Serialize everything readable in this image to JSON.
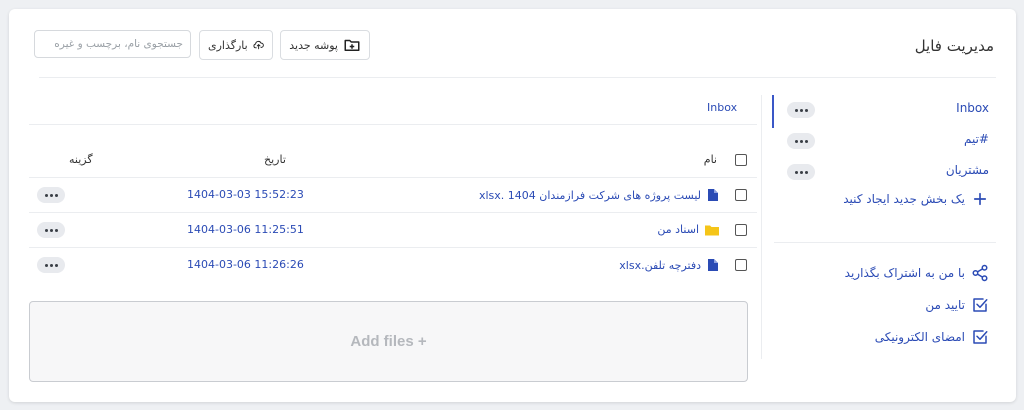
{
  "header": {
    "title": "مدیریت فایل",
    "new_folder_label": "پوشه جدید",
    "upload_label": "بارگذاری",
    "search_placeholder": "جستجوی نام، برچسب و غیره"
  },
  "sidebar": {
    "sections": [
      {
        "label": "Inbox",
        "active": true
      },
      {
        "label": "#تیم"
      },
      {
        "label": "مشتریان"
      }
    ],
    "create_section_label": "یک بخش جدید ایجاد کنید",
    "links": [
      {
        "label": "با من به اشتراک بگذارید",
        "icon": "share-icon"
      },
      {
        "label": "تایید من",
        "icon": "checkbox-icon"
      },
      {
        "label": "امضای الکترونیکی",
        "icon": "checkbox-icon"
      }
    ]
  },
  "main": {
    "breadcrumb": "Inbox",
    "columns": {
      "name": "نام",
      "date": "تاریخ",
      "option": "گزینه"
    },
    "rows": [
      {
        "name": "لیست پروژه های شرکت فرازمندان 1404 .xlsx",
        "date": "1404-03-03 15:52:23",
        "type": "file"
      },
      {
        "name": "اسناد من",
        "date": "1404-03-06 11:25:51",
        "type": "folder"
      },
      {
        "name": "دفترچه تلفن.xlsx",
        "date": "1404-03-06 11:26:26",
        "type": "file"
      }
    ],
    "dropzone_label": "Add files +"
  },
  "colors": {
    "accent": "#2b4bb5",
    "folder": "#f5c518",
    "active_bar": "#3a57c7"
  }
}
